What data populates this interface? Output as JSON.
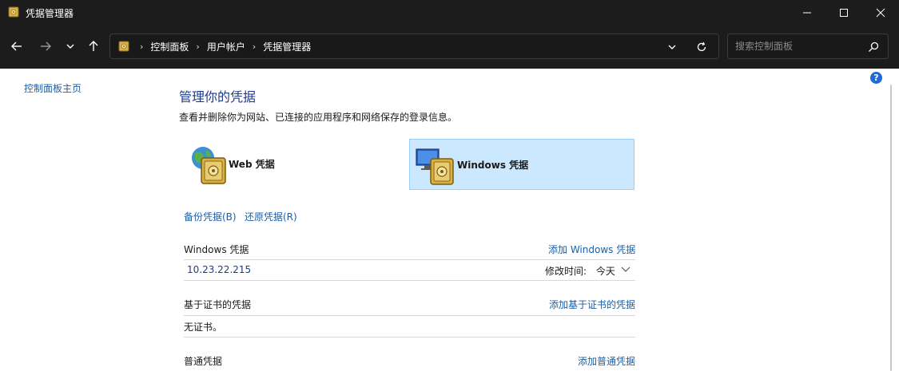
{
  "window": {
    "title": "凭据管理器",
    "minimize_icon": "minimize-icon",
    "maximize_icon": "maximize-icon",
    "close_icon": "close-icon"
  },
  "nav": {
    "breadcrumbs": [
      "控制面板",
      "用户帐户",
      "凭据管理器"
    ],
    "breadcrumb_separator": "›",
    "search_placeholder": "搜索控制面板"
  },
  "sidebar": {
    "home_link": "控制面板主页"
  },
  "help": {
    "label": "?"
  },
  "main": {
    "title": "管理你的凭据",
    "description": "查看并删除你为网站、已连接的应用程序和网络保存的登录信息。",
    "tiles": [
      {
        "label": "Web 凭据",
        "icon": "web-credentials-icon",
        "selected": false
      },
      {
        "label": "Windows 凭据",
        "icon": "windows-credentials-icon",
        "selected": true
      }
    ],
    "backup_link": "备份凭据(B)",
    "restore_link": "还原凭据(R)",
    "sections": {
      "windows": {
        "heading": "Windows 凭据",
        "add_link": "添加 Windows 凭据",
        "items": [
          {
            "name": "10.23.22.215",
            "modified_label": "修改时间:",
            "modified_value": "今天"
          }
        ]
      },
      "certificate": {
        "heading": "基于证书的凭据",
        "add_link": "添加基于证书的凭据",
        "empty_text": "无证书。"
      },
      "generic": {
        "heading": "普通凭据",
        "add_link": "添加普通凭据"
      }
    }
  },
  "colors": {
    "titlebar_bg": "#1c1c1c",
    "link": "#1a5fa8",
    "heading": "#1e3a8a",
    "selected_tile_bg": "#cce8ff",
    "selected_tile_border": "#99d1ff"
  }
}
